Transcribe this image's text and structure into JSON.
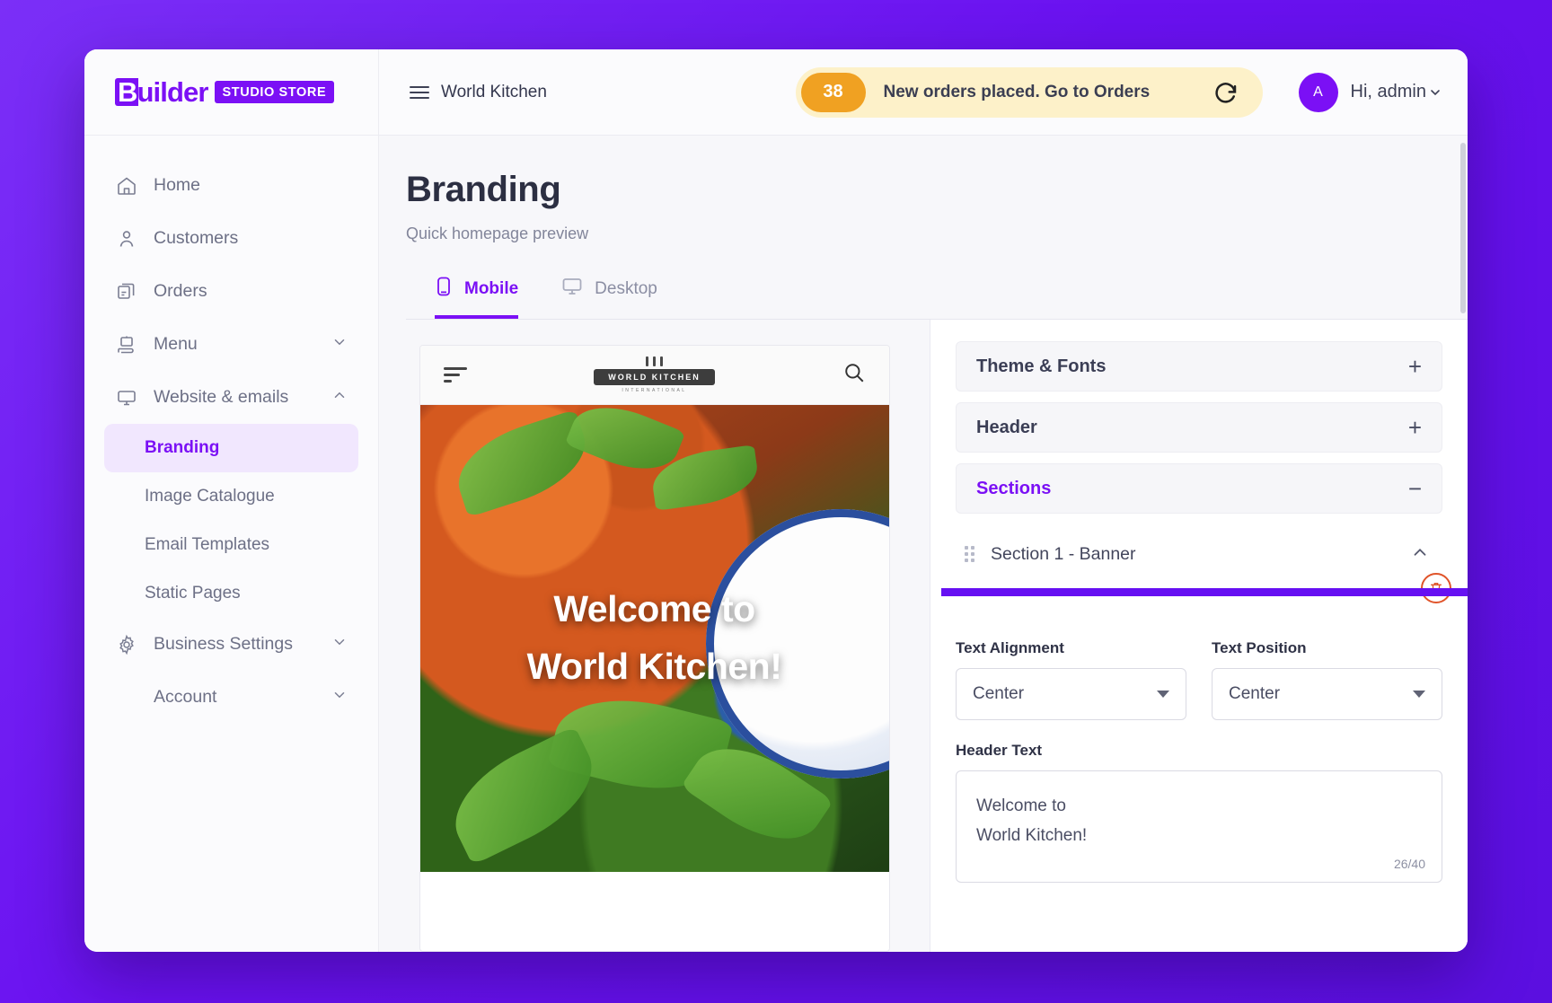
{
  "brand": {
    "name_cap": "B",
    "name_rest": "uilder",
    "badge": "STUDIO STORE"
  },
  "topbar": {
    "store_name": "World Kitchen",
    "menu_icon": "hamburger-icon",
    "notification": {
      "count": "38",
      "message": "New orders placed. Go to Orders",
      "refresh_icon": "refresh-icon",
      "badge_color": "#f0a122",
      "background_color": "#fdf1c9"
    },
    "user": {
      "initial": "A",
      "greeting": "Hi, admin",
      "chevron": "⌄"
    }
  },
  "sidebar": {
    "items": [
      {
        "label": "Home",
        "icon": "home-icon",
        "expandable": false
      },
      {
        "label": "Customers",
        "icon": "user-icon",
        "expandable": false
      },
      {
        "label": "Orders",
        "icon": "orders-icon",
        "expandable": false
      },
      {
        "label": "Menu",
        "icon": "menu-board-icon",
        "expandable": true,
        "expanded": false
      },
      {
        "label": "Website & emails",
        "icon": "monitor-icon",
        "expandable": true,
        "expanded": true
      }
    ],
    "website_children": [
      {
        "label": "Branding",
        "active": true
      },
      {
        "label": "Image Catalogue",
        "active": false
      },
      {
        "label": "Email Templates",
        "active": false
      },
      {
        "label": "Static Pages",
        "active": false
      }
    ],
    "bottom_items": [
      {
        "label": "Business Settings",
        "icon": "gear-icon",
        "expandable": true
      },
      {
        "label": "Account",
        "icon": "",
        "expandable": true
      }
    ],
    "active_color": "#7b10f5"
  },
  "page": {
    "title": "Branding",
    "subtitle": "Quick homepage preview",
    "tabs": [
      {
        "label": "Mobile",
        "icon": "mobile-icon",
        "active": true
      },
      {
        "label": "Desktop",
        "icon": "desktop-icon",
        "active": false
      }
    ]
  },
  "preview": {
    "store_logo_name": "WORLD KITCHEN",
    "store_logo_sub": "INTERNATIONAL",
    "filter_icon": "filter-icon",
    "search_icon": "search-icon",
    "hero_line_1": "Welcome to",
    "hero_line_2": "World Kitchen!"
  },
  "settings": {
    "accordions": [
      {
        "label": "Theme & Fonts",
        "sign": "+",
        "open": false
      },
      {
        "label": "Header",
        "sign": "+",
        "open": false
      },
      {
        "label": "Sections",
        "sign": "−",
        "open": true
      }
    ],
    "section": {
      "label": "Section 1 - Banner",
      "grip_icon": "drag-handle-icon",
      "collapse_icon": "chevron-up-icon",
      "delete_icon": "trash-icon",
      "loading_color": "#6610f2"
    },
    "fields": {
      "text_alignment": {
        "label": "Text Alignment",
        "value": "Center"
      },
      "text_position": {
        "label": "Text Position",
        "value": "Center"
      },
      "header_text": {
        "label": "Header Text",
        "line_1": "Welcome to",
        "line_2": "World Kitchen!",
        "counter": "26/40"
      }
    }
  }
}
